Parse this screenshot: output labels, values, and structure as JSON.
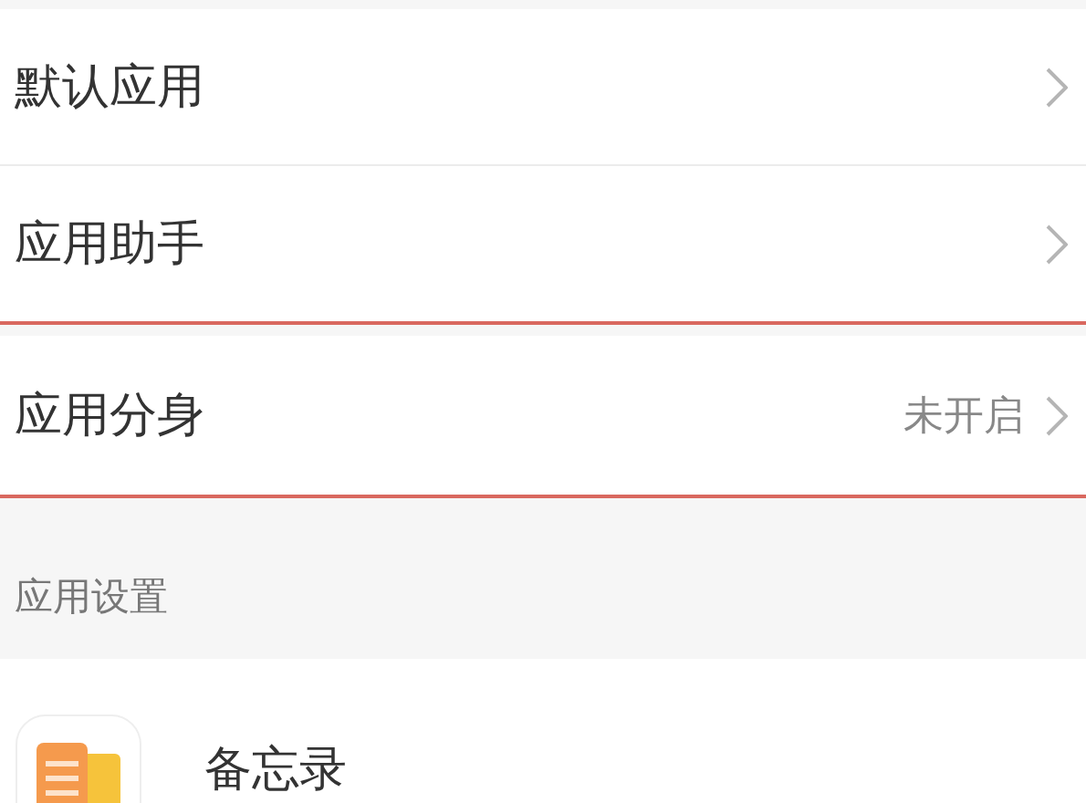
{
  "groups": [
    {
      "highlighted": false,
      "rows": [
        {
          "kind": "plain",
          "label": "默认应用"
        },
        {
          "kind": "plain",
          "label": "应用助手"
        }
      ]
    },
    {
      "highlighted": true,
      "rows": [
        {
          "kind": "plain",
          "label": "应用分身",
          "value": "未开启"
        }
      ]
    }
  ],
  "section": {
    "header": "应用设置",
    "rows": [
      {
        "kind": "app",
        "label": "备忘录"
      }
    ]
  }
}
